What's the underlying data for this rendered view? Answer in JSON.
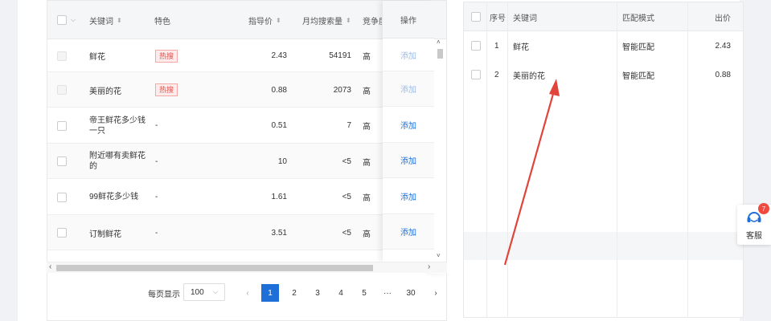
{
  "left_table": {
    "headers": {
      "keyword": "关键词",
      "feature": "特色",
      "guide_price": "指导价",
      "monthly_search": "月均搜索量",
      "competition": "竞争度",
      "action": "操作"
    },
    "rows": [
      {
        "keyword": "鲜花",
        "feature": "热搜",
        "guide_price": "2.43",
        "monthly_search": "54191",
        "competition": "高",
        "action": "添加",
        "disabled": true
      },
      {
        "keyword": "美丽的花",
        "feature": "热搜",
        "guide_price": "0.88",
        "monthly_search": "2073",
        "competition": "高",
        "action": "添加",
        "disabled": true
      },
      {
        "keyword": "帝王鲜花多少钱一只",
        "feature": "-",
        "guide_price": "0.51",
        "monthly_search": "7",
        "competition": "高",
        "action": "添加",
        "disabled": false
      },
      {
        "keyword": "附近哪有卖鲜花的",
        "feature": "-",
        "guide_price": "10",
        "monthly_search": "<5",
        "competition": "高",
        "action": "添加",
        "disabled": false
      },
      {
        "keyword": "99鲜花多少钱",
        "feature": "-",
        "guide_price": "1.61",
        "monthly_search": "<5",
        "competition": "高",
        "action": "添加",
        "disabled": false
      },
      {
        "keyword": "订制鲜花",
        "feature": "-",
        "guide_price": "3.51",
        "monthly_search": "<5",
        "competition": "高",
        "action": "添加",
        "disabled": false
      }
    ]
  },
  "pagination": {
    "page_size_label": "每页显示",
    "page_size": "100",
    "pages": [
      "1",
      "2",
      "3",
      "4",
      "5",
      "···",
      "30"
    ],
    "current": "1"
  },
  "right_table": {
    "headers": {
      "index": "序号",
      "keyword": "关键词",
      "match": "匹配模式",
      "bid": "出价"
    },
    "rows": [
      {
        "index": "1",
        "keyword": "鲜花",
        "match": "智能匹配",
        "bid": "2.43"
      },
      {
        "index": "2",
        "keyword": "美丽的花",
        "match": "智能匹配",
        "bid": "0.88"
      }
    ]
  },
  "customer_service": {
    "label": "客服",
    "badge": "7"
  },
  "colors": {
    "primary": "#1f6fd8",
    "hot_tag": "#e0504a",
    "annotation_arrow": "#e0443a"
  }
}
